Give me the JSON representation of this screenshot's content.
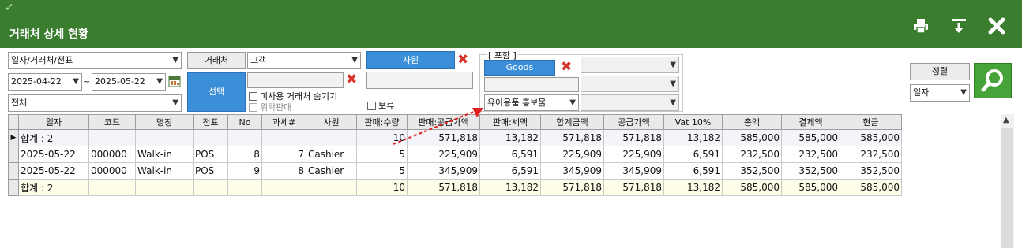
{
  "window": {
    "title": "거래처 상세 현황",
    "check_glyph": "✓",
    "icons": [
      "printer-icon",
      "export-icon",
      "close-icon"
    ]
  },
  "filters": {
    "view_type": "일자/거래처/전표",
    "date_from": "2025-04-22",
    "date_sep": "~",
    "date_to": "2025-05-22",
    "scope": "전체",
    "partner_label": "거래처",
    "partner_type": "고객",
    "select_label": "선택",
    "hide_unused_label": "미사용 거래처 숨기기",
    "consign_label": "위탁판매",
    "employee_label": "사원",
    "hold_label": "보류",
    "include_legend": "[ 포함 ]",
    "goods_label": "Goods",
    "category_value": "유아용품 홍보물",
    "sort_label": "정렬",
    "sort_value": "일자"
  },
  "colors": {
    "title_bar": "#3b7d2e",
    "accent_blue": "#3a8fd8",
    "search_green": "#46a33a",
    "remove_red": "#d9342b"
  },
  "table": {
    "columns": [
      "일자",
      "코드",
      "명칭",
      "전표",
      "No",
      "과세#",
      "사원",
      "판매:수량",
      "판매:공급가액",
      "판매:세액",
      "합계금액",
      "공급가액",
      "Vat 10%",
      "총액",
      "결제액",
      "현금"
    ],
    "rows": [
      {
        "cells": [
          "합계 : 2",
          "",
          "",
          "",
          "",
          "",
          "",
          "10",
          "571,818",
          "13,182",
          "571,818",
          "571,818",
          "13,182",
          "585,000",
          "585,000",
          "585,000"
        ]
      },
      {
        "cells": [
          "2025-05-22",
          "000000",
          "Walk-in",
          "POS",
          "8",
          "7",
          "Cashier",
          "5",
          "225,909",
          "6,591",
          "225,909",
          "225,909",
          "6,591",
          "232,500",
          "232,500",
          "232,500"
        ]
      },
      {
        "cells": [
          "2025-05-22",
          "000000",
          "Walk-in",
          "POS",
          "9",
          "8",
          "Cashier",
          "5",
          "345,909",
          "6,591",
          "345,909",
          "345,909",
          "6,591",
          "352,500",
          "352,500",
          "352,500"
        ]
      },
      {
        "cells": [
          "합계 : 2",
          "",
          "",
          "",
          "",
          "",
          "",
          "10",
          "571,818",
          "13,182",
          "571,818",
          "571,818",
          "13,182",
          "585,000",
          "585,000",
          "585,000"
        ]
      }
    ]
  }
}
